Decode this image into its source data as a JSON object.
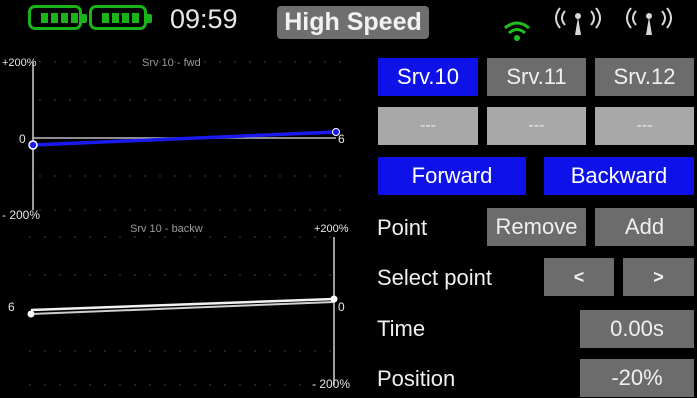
{
  "status": {
    "time": "09:59",
    "mode": "High Speed",
    "icons": {
      "wifi": "wifi-icon",
      "antenna1": "antenna-icon",
      "antenna2": "antenna-icon"
    },
    "colors": {
      "battery": "#1ab41a",
      "wifi": "#1fbf1f",
      "accent": "#0e12e8"
    }
  },
  "charts": {
    "forward": {
      "title": "Srv 10 - fwd",
      "top_label": "+200%",
      "bottom_label": "- 200%",
      "left_value": "0",
      "right_value": "6"
    },
    "backward": {
      "title": "Srv 10 - backw",
      "top_label": "+200%",
      "bottom_label": "- 200%",
      "left_value": "6",
      "right_value": "0"
    }
  },
  "servos": {
    "srv10": "Srv.10",
    "srv11": "Srv.11",
    "srv12": "Srv.12"
  },
  "slots": {
    "a": "---",
    "b": "---",
    "c": "---"
  },
  "direction": {
    "forward": "Forward",
    "backward": "Backward"
  },
  "point": {
    "label": "Point",
    "remove": "Remove",
    "add": "Add"
  },
  "select_point": {
    "label": "Select point",
    "prev": "<",
    "next": ">"
  },
  "time": {
    "label": "Time",
    "value": "0.00s"
  },
  "position": {
    "label": "Position",
    "value": "-20%"
  }
}
